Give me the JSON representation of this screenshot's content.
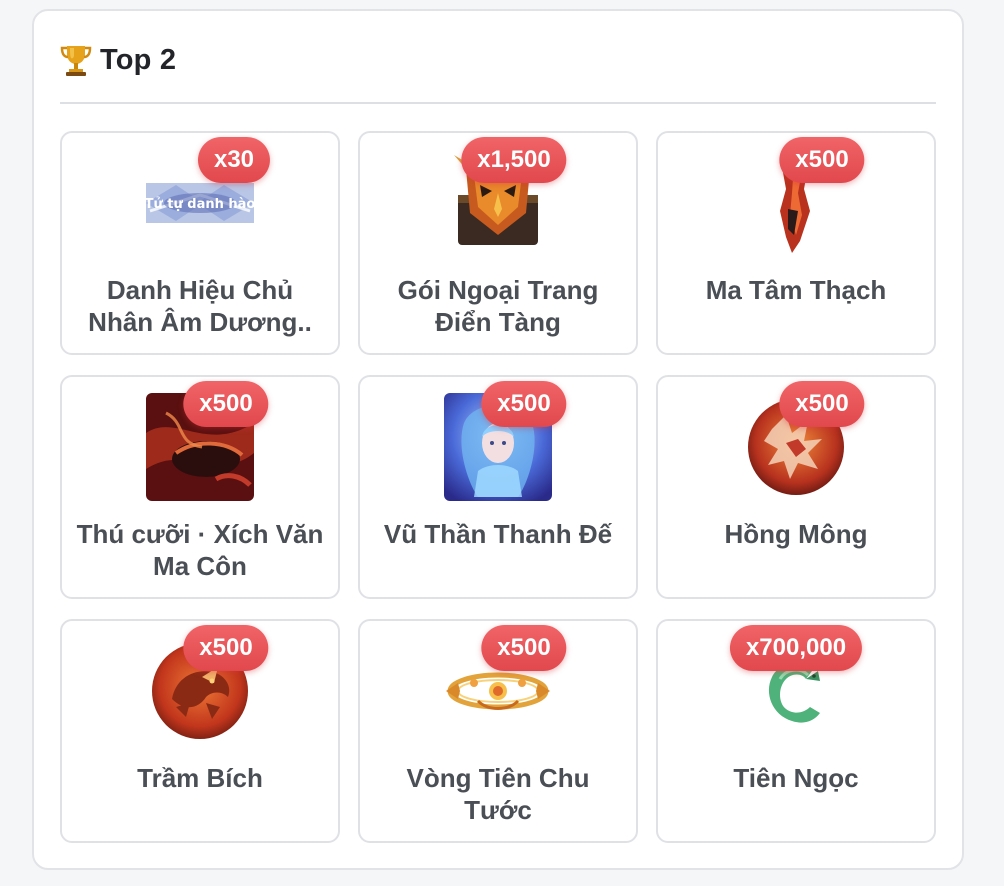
{
  "panel": {
    "title": "Top 2",
    "icon": "trophy-icon"
  },
  "rewards": [
    {
      "qty": "x30",
      "name": "Danh Hiệu Chủ Nhân Âm Dương..",
      "icon": "title-banner-image"
    },
    {
      "qty": "x1,500",
      "name": "Gói Ngoại Trang Điển Tàng",
      "icon": "mask-chest-image"
    },
    {
      "qty": "x500",
      "name": "Ma Tâm Thạch",
      "icon": "red-crystal-image"
    },
    {
      "qty": "x500",
      "name": "Thú cưỡi · Xích Văn Ma Côn",
      "icon": "mount-image"
    },
    {
      "qty": "x500",
      "name": "Vũ Thần Thanh Đế",
      "icon": "goddess-portrait-image"
    },
    {
      "qty": "x500",
      "name": "Hồng Mông",
      "icon": "red-beast-medallion-image"
    },
    {
      "qty": "x500",
      "name": "Trầm Bích",
      "icon": "dragon-medallion-image"
    },
    {
      "qty": "x500",
      "name": "Vòng Tiên Chu Tước",
      "icon": "golden-halo-image"
    },
    {
      "qty": "x700,000",
      "name": "Tiên Ngọc",
      "icon": "jade-image"
    }
  ],
  "colors": {
    "badge": "#e5484d",
    "title": "#222429",
    "item_text": "#4a4e55",
    "border": "#dfe1e5"
  }
}
